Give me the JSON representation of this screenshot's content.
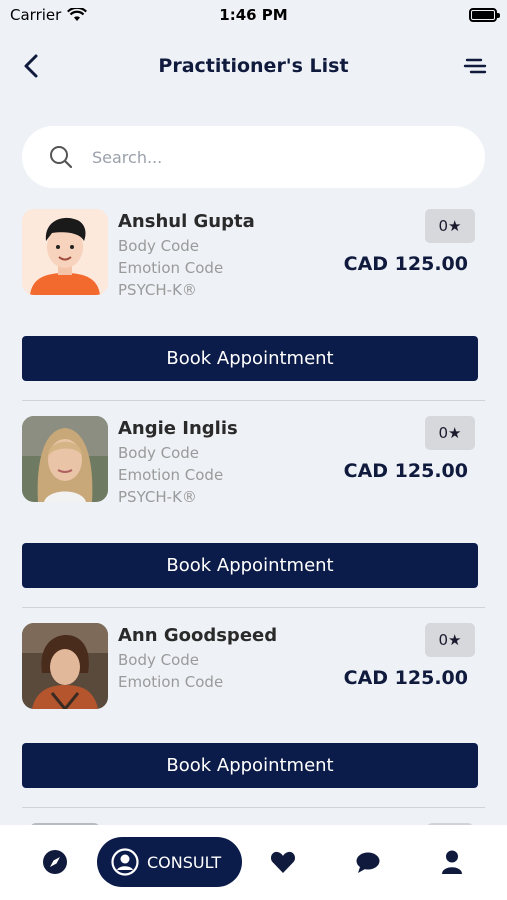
{
  "status": {
    "carrier": "Carrier",
    "time": "1:46 PM"
  },
  "header": {
    "title": "Practitioner's List",
    "back_icon": "chevron-left-icon",
    "menu_icon": "filter-lines-icon"
  },
  "search": {
    "placeholder": "Search...",
    "value": ""
  },
  "practitioners": [
    {
      "name": "Anshul Gupta",
      "specialties": [
        "Body Code",
        "Emotion Code",
        "PSYCH-K®"
      ],
      "rating": "0★",
      "price": "CAD 125.00",
      "button": "Book Appointment"
    },
    {
      "name": "Angie Inglis",
      "specialties": [
        "Body Code",
        "Emotion Code",
        "PSYCH-K®"
      ],
      "rating": "0★",
      "price": "CAD 125.00",
      "button": "Book Appointment"
    },
    {
      "name": "Ann Goodspeed",
      "specialties": [
        "Body Code",
        "Emotion Code"
      ],
      "rating": "0★",
      "price": "CAD 125.00",
      "button": "Book Appointment"
    }
  ],
  "bottom_nav": {
    "consult_label": "CONSULT",
    "items": [
      "compass-icon",
      "user-circle-icon",
      "heart-icon",
      "chat-icon",
      "person-icon"
    ]
  },
  "colors": {
    "primary": "#0c1c4a",
    "background": "#eef1f6",
    "muted_text": "#9a9a9a"
  }
}
